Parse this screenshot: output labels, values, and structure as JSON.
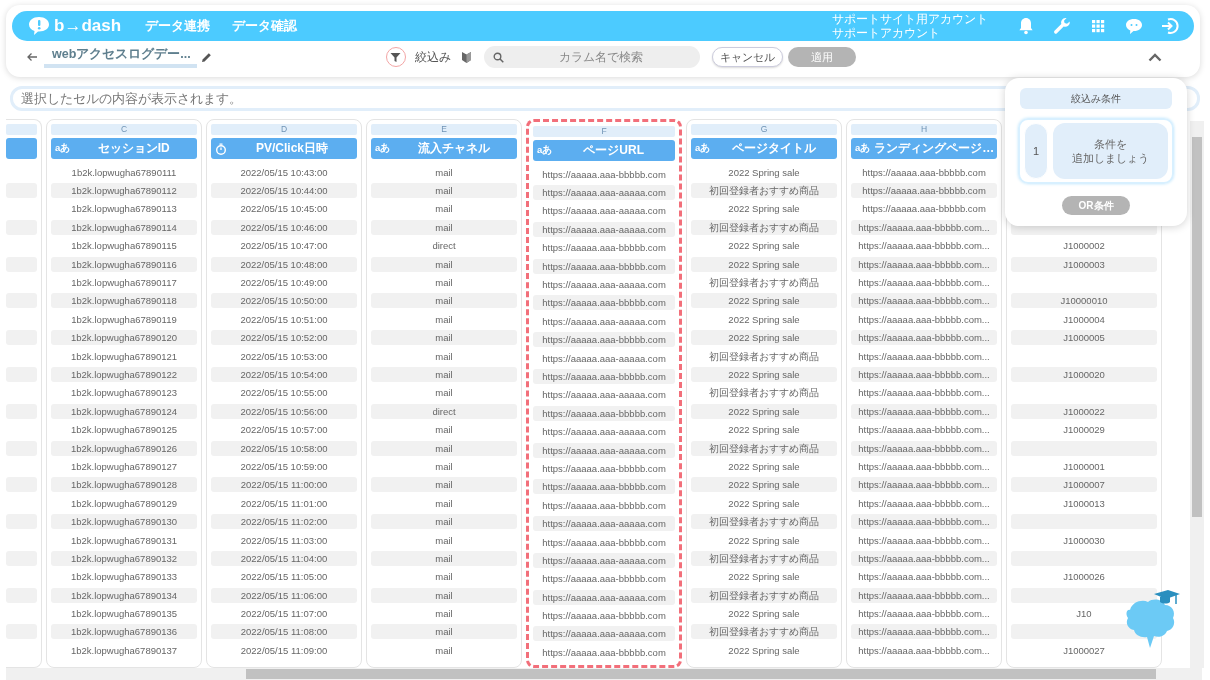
{
  "nav": {
    "logo": "b→dash",
    "links": [
      "データ連携",
      "データ確認"
    ],
    "account": [
      "サポートサイト用アカウント",
      "サポートアカウント"
    ]
  },
  "toolbar": {
    "title": "webアクセスログデー...",
    "filter_label": "絞込み",
    "search": {
      "placeholder": "カラム名で検索"
    },
    "cancel": "キャンセル",
    "apply": {
      "label": "適用",
      "disabled": true
    }
  },
  "cell_viewer": {
    "placeholder": "選択したセルの内容が表示されます。"
  },
  "filter_panel": {
    "title": "絞込み条件",
    "index": "1",
    "prompt_lines": [
      "条件を",
      "追加しましょう"
    ],
    "or_button": {
      "label": "OR条件",
      "disabled": true
    }
  },
  "table": {
    "columns": [
      {
        "kind": "partial",
        "selected": false
      },
      {
        "kind": "text",
        "letter": "C",
        "title": "セッションID",
        "type_label": "aあ",
        "selected": false
      },
      {
        "kind": "datetime",
        "letter": "D",
        "title": "PV/Click日時",
        "selected": false
      },
      {
        "kind": "text",
        "letter": "E",
        "title": "流入チャネル",
        "type_label": "aあ",
        "selected": false
      },
      {
        "kind": "text",
        "letter": "F",
        "title": "ページURL",
        "type_label": "aあ",
        "selected": true
      },
      {
        "kind": "text",
        "letter": "G",
        "title": "ページタイトル",
        "type_label": "aあ",
        "selected": false
      },
      {
        "kind": "text",
        "letter": "H",
        "title": "ランディングページ…",
        "type_label": "aあ",
        "selected": false
      },
      {
        "kind": "hidden",
        "selected": false
      }
    ],
    "rows": [
      [
        null,
        "1b2k.lopwugha67890111",
        "2022/05/15 10:43:00",
        "mail",
        "https://aaaaa.aaa-bbbbb.com",
        "2022 Spring sale",
        "https://aaaaa.aaa-bbbbb.com",
        null
      ],
      [
        null,
        "1b2k.lopwugha67890112",
        "2022/05/15 10:44:00",
        "mail",
        "https://aaaaa.aaa-aaaaa.com",
        "初回登録者おすすめ商品",
        "https://aaaaa.aaa-bbbbb.com",
        null
      ],
      [
        null,
        "1b2k.lopwugha67890113",
        "2022/05/15 10:45:00",
        "mail",
        "https://aaaaa.aaa-aaaaa.com",
        "2022 Spring sale",
        "https://aaaaa.aaa-bbbbb.com",
        null
      ],
      [
        null,
        "1b2k.lopwugha67890114",
        "2022/05/15 10:46:00",
        "mail",
        "https://aaaaa.aaa-aaaaa.com",
        "初回登録者おすすめ商品",
        "https://aaaaa.aaa-bbbbb.com...",
        null
      ],
      [
        null,
        "1b2k.lopwugha67890115",
        "2022/05/15 10:47:00",
        "direct",
        "https://aaaaa.aaa-bbbbb.com",
        "2022 Spring sale",
        "https://aaaaa.aaa-bbbbb.com...",
        "J1000002"
      ],
      [
        null,
        "1b2k.lopwugha67890116",
        "2022/05/15 10:48:00",
        "mail",
        "https://aaaaa.aaa-bbbbb.com",
        "2022 Spring sale",
        "https://aaaaa.aaa-bbbbb.com...",
        "J1000003"
      ],
      [
        null,
        "1b2k.lopwugha67890117",
        "2022/05/15 10:49:00",
        "mail",
        "https://aaaaa.aaa-aaaaa.com",
        "初回登録者おすすめ商品",
        "https://aaaaa.aaa-bbbbb.com...",
        null
      ],
      [
        null,
        "1b2k.lopwugha67890118",
        "2022/05/15 10:50:00",
        "mail",
        "https://aaaaa.aaa-bbbbb.com",
        "2022 Spring sale",
        "https://aaaaa.aaa-bbbbb.com...",
        "J10000010"
      ],
      [
        null,
        "1b2k.lopwugha67890119",
        "2022/05/15 10:51:00",
        "mail",
        "https://aaaaa.aaa-aaaaa.com",
        "2022 Spring sale",
        "https://aaaaa.aaa-bbbbb.com...",
        "J1000004"
      ],
      [
        null,
        "1b2k.lopwugha67890120",
        "2022/05/15 10:52:00",
        "mail",
        "https://aaaaa.aaa-bbbbb.com",
        "2022 Spring sale",
        "https://aaaaa.aaa-bbbbb.com...",
        "J1000005"
      ],
      [
        null,
        "1b2k.lopwugha67890121",
        "2022/05/15 10:53:00",
        "mail",
        "https://aaaaa.aaa-aaaaa.com",
        "初回登録者おすすめ商品",
        "https://aaaaa.aaa-bbbbb.com...",
        null
      ],
      [
        null,
        "1b2k.lopwugha67890122",
        "2022/05/15 10:54:00",
        "mail",
        "https://aaaaa.aaa-bbbbb.com",
        "2022 Spring sale",
        "https://aaaaa.aaa-bbbbb.com...",
        "J1000020"
      ],
      [
        null,
        "1b2k.lopwugha67890123",
        "2022/05/15 10:55:00",
        "mail",
        "https://aaaaa.aaa-aaaaa.com",
        "初回登録者おすすめ商品",
        "https://aaaaa.aaa-bbbbb.com...",
        null
      ],
      [
        null,
        "1b2k.lopwugha67890124",
        "2022/05/15 10:56:00",
        "direct",
        "https://aaaaa.aaa-bbbbb.com",
        "2022 Spring sale",
        "https://aaaaa.aaa-bbbbb.com...",
        "J1000022"
      ],
      [
        null,
        "1b2k.lopwugha67890125",
        "2022/05/15 10:57:00",
        "mail",
        "https://aaaaa.aaa-aaaaa.com",
        "2022 Spring sale",
        "https://aaaaa.aaa-bbbbb.com...",
        "J1000029"
      ],
      [
        null,
        "1b2k.lopwugha67890126",
        "2022/05/15 10:58:00",
        "mail",
        "https://aaaaa.aaa-aaaaa.com",
        "初回登録者おすすめ商品",
        "https://aaaaa.aaa-bbbbb.com...",
        null
      ],
      [
        null,
        "1b2k.lopwugha67890127",
        "2022/05/15 10:59:00",
        "mail",
        "https://aaaaa.aaa-bbbbb.com",
        "2022 Spring sale",
        "https://aaaaa.aaa-bbbbb.com...",
        "J1000001"
      ],
      [
        null,
        "1b2k.lopwugha67890128",
        "2022/05/15 11:00:00",
        "mail",
        "https://aaaaa.aaa-bbbbb.com",
        "2022 Spring sale",
        "https://aaaaa.aaa-bbbbb.com...",
        "J1000007"
      ],
      [
        null,
        "1b2k.lopwugha67890129",
        "2022/05/15 11:01:00",
        "mail",
        "https://aaaaa.aaa-bbbbb.com",
        "2022 Spring sale",
        "https://aaaaa.aaa-bbbbb.com...",
        "J1000013"
      ],
      [
        null,
        "1b2k.lopwugha67890130",
        "2022/05/15 11:02:00",
        "mail",
        "https://aaaaa.aaa-aaaaa.com",
        "初回登録者おすすめ商品",
        "https://aaaaa.aaa-bbbbb.com...",
        null
      ],
      [
        null,
        "1b2k.lopwugha67890131",
        "2022/05/15 11:03:00",
        "mail",
        "https://aaaaa.aaa-bbbbb.com",
        "2022 Spring sale",
        "https://aaaaa.aaa-bbbbb.com...",
        "J1000030"
      ],
      [
        null,
        "1b2k.lopwugha67890132",
        "2022/05/15 11:04:00",
        "mail",
        "https://aaaaa.aaa-aaaaa.com",
        "初回登録者おすすめ商品",
        "https://aaaaa.aaa-bbbbb.com...",
        null
      ],
      [
        null,
        "1b2k.lopwugha67890133",
        "2022/05/15 11:05:00",
        "mail",
        "https://aaaaa.aaa-bbbbb.com",
        "2022 Spring sale",
        "https://aaaaa.aaa-bbbbb.com...",
        "J1000026"
      ],
      [
        null,
        "1b2k.lopwugha67890134",
        "2022/05/15 11:06:00",
        "mail",
        "https://aaaaa.aaa-aaaaa.com",
        "初回登録者おすすめ商品",
        "https://aaaaa.aaa-bbbbb.com...",
        null
      ],
      [
        null,
        "1b2k.lopwugha67890135",
        "2022/05/15 11:07:00",
        "mail",
        "https://aaaaa.aaa-bbbbb.com",
        "2022 Spring sale",
        "https://aaaaa.aaa-bbbbb.com...",
        "J10"
      ],
      [
        null,
        "1b2k.lopwugha67890136",
        "2022/05/15 11:08:00",
        "mail",
        "https://aaaaa.aaa-aaaaa.com",
        "初回登録者おすすめ商品",
        "https://aaaaa.aaa-bbbbb.com...",
        null
      ],
      [
        null,
        "1b2k.lopwugha67890137",
        "2022/05/15 11:09:00",
        "mail",
        "https://aaaaa.aaa-bbbbb.com",
        "2022 Spring sale",
        "https://aaaaa.aaa-bbbbb.com...",
        "J1000027"
      ]
    ]
  }
}
